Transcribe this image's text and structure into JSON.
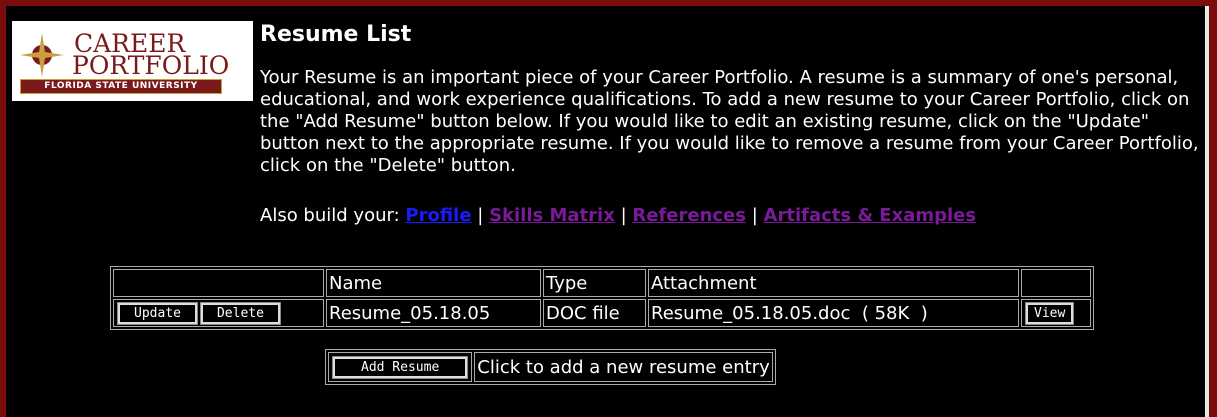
{
  "logo": {
    "line1": "CAREER",
    "line2": "PORTFOLIO",
    "band": "FLORIDA STATE UNIVERSITY"
  },
  "page": {
    "title": "Resume List",
    "intro": "Your Resume is an important piece of your Career Portfolio. A resume is a summary of one's personal, educational, and work experience qualifications. To add a new resume to your Career Portfolio, click on the \"Add Resume\" button below. If you would like to edit an existing resume, click on the \"Update\" button next to the appropriate resume. If you would like to remove a resume from your Career Portfolio, click on the \"Delete\" button.",
    "also_label": "Also build your:",
    "links": {
      "profile": "Profile",
      "skills": "Skills Matrix",
      "references": "References",
      "artifacts": "Artifacts & Examples"
    },
    "sep": "|"
  },
  "table": {
    "headers": {
      "name": "Name",
      "type": "Type",
      "attachment": "Attachment"
    },
    "rows": [
      {
        "update_label": "Update",
        "delete_label": "Delete",
        "name": "Resume_05.18.05",
        "type": "DOC file",
        "attachment": "Resume_05.18.05.doc  ( 58K  )",
        "view_label": "View"
      }
    ]
  },
  "add": {
    "button_label": "Add Resume",
    "hint": "Click to add a new resume entry"
  },
  "colors": {
    "border_red": "#7a0c0c",
    "background": "#000000",
    "link_unvisited": "#1a1aff",
    "link_visited": "#7a1a9a"
  }
}
